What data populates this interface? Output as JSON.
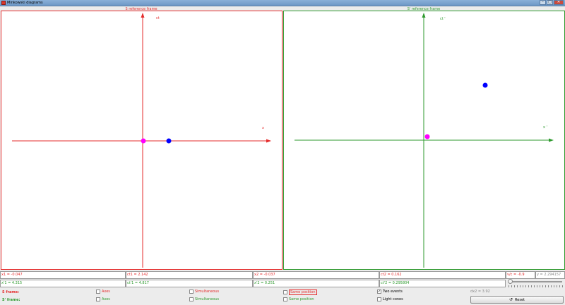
{
  "window": {
    "title": "Minkowski diagrams",
    "minimize": "–",
    "maximize": "□",
    "close": "✕"
  },
  "panels": {
    "s": {
      "title": "S reference frame",
      "time_label": "ct",
      "space_label": "x"
    },
    "sprime": {
      "title": "S' reference frame",
      "time_label": "ct '",
      "space_label": "x '"
    }
  },
  "colors": {
    "s_frame": "#e52b2b",
    "sprime_frame": "#2e9a2e",
    "event1": "#ff00ff",
    "event2": "#0000ff"
  },
  "readouts": {
    "x1": "x1 = -0.047",
    "ct1": "ct1 = 2.142",
    "x2": "x2 = -0.037",
    "ct2": "ct2 = 0.162",
    "v": "v/c = -0.9",
    "gamma": "γ = 2.294157",
    "x1p": "x'1 = 4.315",
    "ct1p": "ct'1 = 4.817",
    "x2p": "x'2 = 0.251",
    "ct2p": "ct'2 = 0.295804"
  },
  "controls": {
    "s_frame_label": "S frame:",
    "sprime_frame_label": "S' frame:",
    "axes": "Axes",
    "simultaneous": "Simultaneous",
    "same_position": "Same position",
    "two_events": "Two events",
    "light_cones": "Light cones",
    "two_events_checked": true,
    "dx2": "dx2 = 3.92",
    "reset": "Reset"
  },
  "speed_slider": {
    "value": -0.9,
    "min": -1,
    "max": 1
  }
}
